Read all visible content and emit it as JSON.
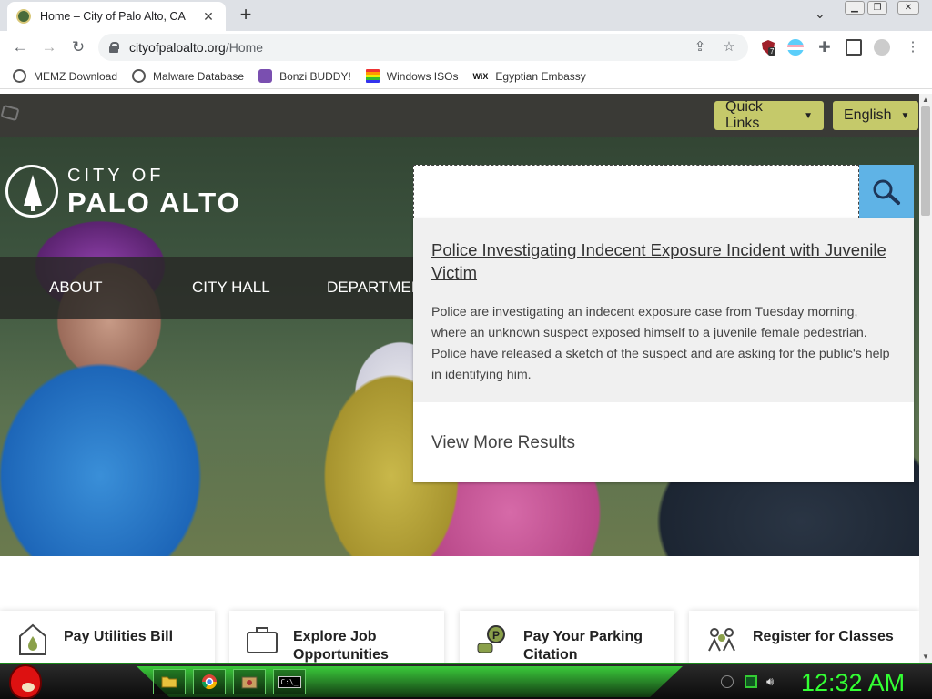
{
  "browser": {
    "tab_title": "Home – City of Palo Alto, CA",
    "url_host": "cityofpaloalto.org",
    "url_path": "/Home",
    "bookmarks": [
      {
        "label": "MEMZ Download",
        "icon": "globe-icon"
      },
      {
        "label": "Malware Database",
        "icon": "globe-icon"
      },
      {
        "label": "Bonzi BUDDY!",
        "icon": "bonzi-icon"
      },
      {
        "label": "Windows ISOs",
        "icon": "windows-icon"
      },
      {
        "label": "Egyptian Embassy",
        "icon": "wix-icon"
      }
    ],
    "wix_icon_text": "WiX",
    "extension_badge": "7"
  },
  "site": {
    "logo_line1": "CITY OF",
    "logo_line2": "PALO ALTO",
    "quick_links_label": "Quick Links",
    "language_label": "English",
    "nav": [
      "ABOUT",
      "CITY HALL",
      "DEPARTMENTS"
    ],
    "search": {
      "value": ""
    },
    "results": {
      "first_title": "Police Investigating Indecent Exposure Incident with Juvenile Victim",
      "first_description": "Police are investigating an indecent exposure case from Tuesday morning, where an unknown suspect exposed himself to a juvenile female pedestrian. Police have released a sketch of the suspect and are asking for the public's help in identifying him.",
      "more_label": "View More Results"
    },
    "cards": [
      {
        "label": "Pay Utilities Bill",
        "icon": "utility-drop-icon"
      },
      {
        "label": "Explore Job Opportunities",
        "icon": "briefcase-icon"
      },
      {
        "label": "Pay Your Parking Citation",
        "icon": "parking-meter-icon"
      },
      {
        "label": "Register for Classes",
        "icon": "classes-people-icon"
      }
    ]
  },
  "taskbar": {
    "clock": "12:32 AM",
    "apps": [
      "folder-icon",
      "chrome-icon",
      "media-icon",
      "cmd-icon"
    ],
    "cmd_text": "C:\\_"
  },
  "colors": {
    "accent_olive": "#c5c96a",
    "search_blue": "#5fb3e6",
    "clock_green": "#33ff33"
  }
}
